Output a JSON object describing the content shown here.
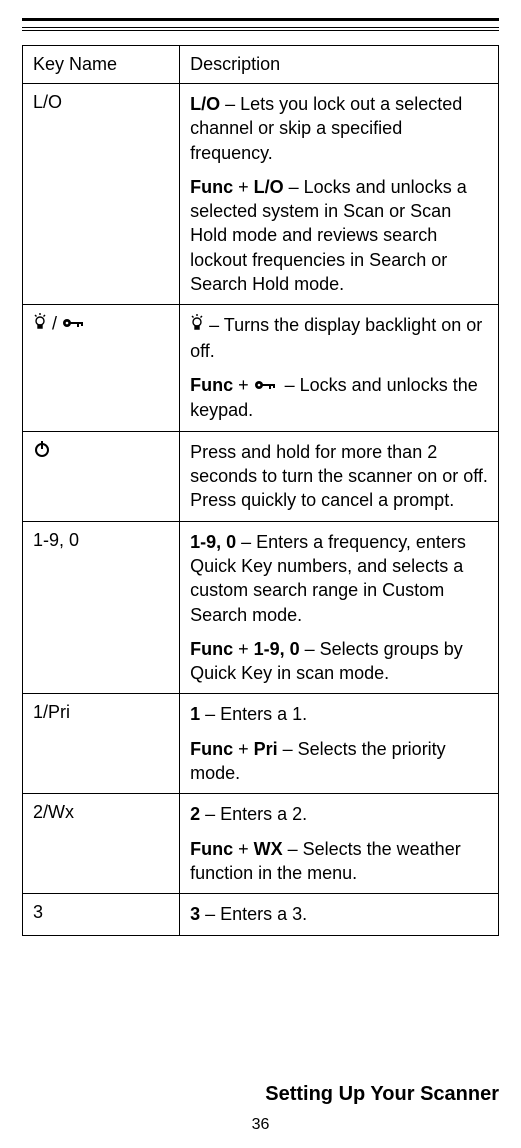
{
  "table": {
    "headers": {
      "key": "Key Name",
      "desc": "Description"
    },
    "rows": [
      {
        "key_text": "L/O",
        "parts": [
          {
            "bold": "L/O",
            "sep": " – ",
            "text": "Lets you lock out a selected channel or skip a specified frequency."
          },
          {
            "bold": "Func",
            "sep": " + ",
            "bold2": "L/O",
            "sep2": " – ",
            "text": "Locks and unlocks a selected system in Scan or Scan Hold mode and reviews search lockout frequencies in Search or Search Hold mode."
          }
        ]
      },
      {
        "key_icons": [
          "bulb",
          "slash",
          "keylock"
        ],
        "parts": [
          {
            "icon": "bulb",
            "sep": " – ",
            "text": "Turns the display backlight on or off."
          },
          {
            "bold": "Func",
            "sep": " + ",
            "icon2": "keylock",
            "sep2": " – ",
            "text": "Locks and unlocks the keypad."
          }
        ]
      },
      {
        "key_icons": [
          "power"
        ],
        "parts": [
          {
            "text": "Press and hold for more than 2 seconds to turn the scanner on or off. Press quickly to cancel a prompt."
          }
        ]
      },
      {
        "key_text": "1-9, 0",
        "parts": [
          {
            "bold": "1-9, 0",
            "sep": " – ",
            "text": "Enters a frequency, enters Quick Key numbers, and selects a custom search range in Custom Search mode."
          },
          {
            "bold": "Func",
            "sep": " + ",
            "bold2": "1-9, 0",
            "sep2": " – ",
            "text": "Selects groups by Quick Key in scan mode."
          }
        ]
      },
      {
        "key_text": "1/Pri",
        "parts": [
          {
            "bold": "1",
            "sep": " – ",
            "text": "Enters a 1."
          },
          {
            "bold": "Func",
            "sep": " + ",
            "bold2": "Pri",
            "sep2": " – ",
            "text": "Selects the priority mode."
          }
        ]
      },
      {
        "key_text": "2/Wx",
        "parts": [
          {
            "bold": "2",
            "sep": " – ",
            "text": "Enters a 2."
          },
          {
            "bold": "Func",
            "sep": " + ",
            "bold2": "WX",
            "sep2": " – ",
            "text": "Selects the weather function in the menu."
          }
        ]
      },
      {
        "key_text": "3",
        "parts": [
          {
            "bold": "3",
            "sep": " – ",
            "text": "Enters a 3."
          }
        ]
      }
    ]
  },
  "footer": {
    "title": "Setting Up Your Scanner",
    "page": "36"
  },
  "slash": " / "
}
